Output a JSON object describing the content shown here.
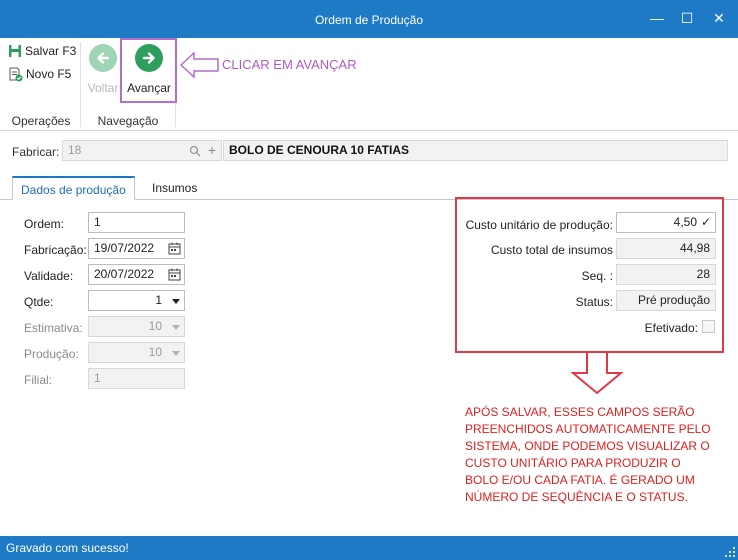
{
  "window": {
    "title": "Ordem de Produção",
    "controls": {
      "minimize": "—",
      "maximize": "☐",
      "close": "✕"
    }
  },
  "ribbon": {
    "operations": {
      "label": "Operações",
      "save_label": "Salvar F3",
      "new_label": "Novo F5"
    },
    "navigation": {
      "label": "Navegação",
      "back_label": "Voltar",
      "next_label": "Avançar"
    },
    "callout": "CLICAR EM AVANÇAR"
  },
  "fabricar": {
    "label": "Fabricar:",
    "code": "18",
    "description": "BOLO DE CENOURA 10 FATIAS"
  },
  "tabs": [
    {
      "label": "Dados de produção",
      "active": true
    },
    {
      "label": "Insumos",
      "active": false
    }
  ],
  "form": {
    "ordem": {
      "label": "Ordem:",
      "value": "1"
    },
    "fabricacao": {
      "label": "Fabricação:",
      "value": "19/07/2022"
    },
    "validade": {
      "label": "Validade:",
      "value": "20/07/2022"
    },
    "qtde": {
      "label": "Qtde:",
      "value": "1"
    },
    "estimativa": {
      "label": "Estimativa:",
      "value": "10"
    },
    "producao": {
      "label": "Produção:",
      "value": "10"
    },
    "filial": {
      "label": "Filial:",
      "value": "1"
    }
  },
  "summary": {
    "custo_unitario": {
      "label": "Custo unitário de produção:",
      "value": "4,50",
      "check": "✓"
    },
    "custo_total": {
      "label": "Custo total de insumos",
      "value": "44,98"
    },
    "seq": {
      "label": "Seq. :",
      "value": "28"
    },
    "status": {
      "label": "Status:",
      "value": "Pré produção"
    },
    "efetivado": {
      "label": "Efetivado:",
      "checked": false
    }
  },
  "note": "APÓS SALVAR, ESSES CAMPOS SERÃO PREENCHIDOS AUTOMATICAMENTE PELO SISTEMA, ONDE PODEMOS VISUALIZAR O CUSTO UNITÁRIO PARA PRODUZIR O BOLO E/OU CADA FATIA. É GERADO UM NÚMERO DE SEQUÊNCIA E O STATUS.",
  "statusbar": {
    "message": "Gravado com sucesso!"
  },
  "colors": {
    "titlebar": "#1f7ac6",
    "accent_green": "#2e9e5e",
    "highlight_purple": "#b46fc8",
    "highlight_red": "#e0394b",
    "note_red": "#e01e1e"
  }
}
